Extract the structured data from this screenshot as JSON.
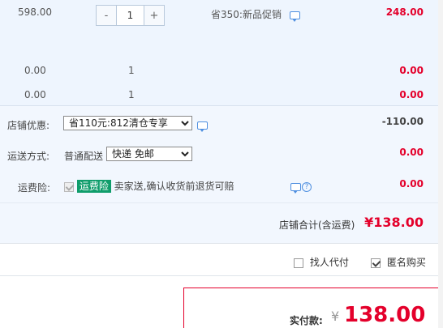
{
  "item": {
    "orig_price": "598.00",
    "stepper": {
      "minus": "-",
      "qty": "1",
      "plus": "+"
    },
    "promo_text": "省350:新品促销",
    "price": "248.00"
  },
  "free_rows": [
    {
      "orig_price": "0.00",
      "qty": "1",
      "price": "0.00"
    },
    {
      "orig_price": "0.00",
      "qty": "1",
      "price": "0.00"
    }
  ],
  "shop": {
    "discount_label": "店铺优惠:",
    "discount_selected": "省110元:812清仓专享",
    "discount_amount": "-110.00",
    "shipping_label": "运送方式:",
    "shipping_type": "普通配送",
    "shipping_selected": "快递 免邮",
    "shipping_amount": "0.00",
    "insurance_label": "运费险:",
    "insurance_badge": "运费险",
    "insurance_desc": "卖家送,确认收货前退货可赔",
    "insurance_amount": "0.00",
    "total_label": "店铺合计(含运费)",
    "total_amount": "¥138.00"
  },
  "options": {
    "proxy_label": "找人代付",
    "anonymous_label": "匿名购买"
  },
  "payment": {
    "label": "实付款:",
    "currency": "¥",
    "amount": "138.00"
  },
  "icons": {
    "chat": "chat-bubble-icon",
    "help": "question-icon"
  },
  "colors": {
    "price_red": "#e4002b",
    "badge_green": "#0f9d6b",
    "link_blue": "#4f8fe0",
    "panel_bg": "#eef5fe"
  }
}
